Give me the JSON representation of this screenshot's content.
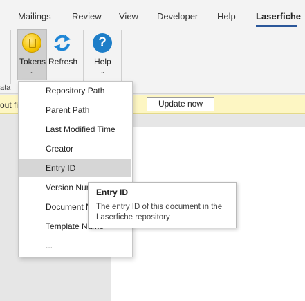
{
  "tabs": [
    {
      "label": "Mailings"
    },
    {
      "label": "Review"
    },
    {
      "label": "View"
    },
    {
      "label": "Developer"
    },
    {
      "label": "Help"
    },
    {
      "label": "Laserfiche"
    }
  ],
  "ribbon": {
    "left_partial_label": "ata",
    "tokens": {
      "label": "Tokens",
      "icon": "tokens-icon"
    },
    "refresh": {
      "label": "Refresh",
      "icon": "refresh-icon"
    },
    "help": {
      "label": "Help",
      "icon": "help-icon",
      "glyph": "?"
    },
    "dropdown_glyph": "⌄"
  },
  "infobar": {
    "partial_text": "out fi",
    "button_label": "Update now"
  },
  "menu": {
    "items": [
      {
        "label": "Repository Path"
      },
      {
        "label": "Parent Path"
      },
      {
        "label": "Last Modified Time"
      },
      {
        "label": "Creator"
      },
      {
        "label": "Entry ID"
      },
      {
        "label": "Version Number"
      },
      {
        "label": "Document Name"
      },
      {
        "label": "Template Name"
      },
      {
        "label": "..."
      }
    ],
    "hovered_index": 4
  },
  "tooltip": {
    "title": "Entry ID",
    "description": "The entry ID of this document in the Laserfiche repository"
  },
  "colors": {
    "accent": "#2b579a",
    "infobar_bg": "#fdf6c3",
    "help_blue": "#1e7ec8",
    "token_yellow": "#f5c400",
    "refresh_blue": "#1f86d6"
  }
}
